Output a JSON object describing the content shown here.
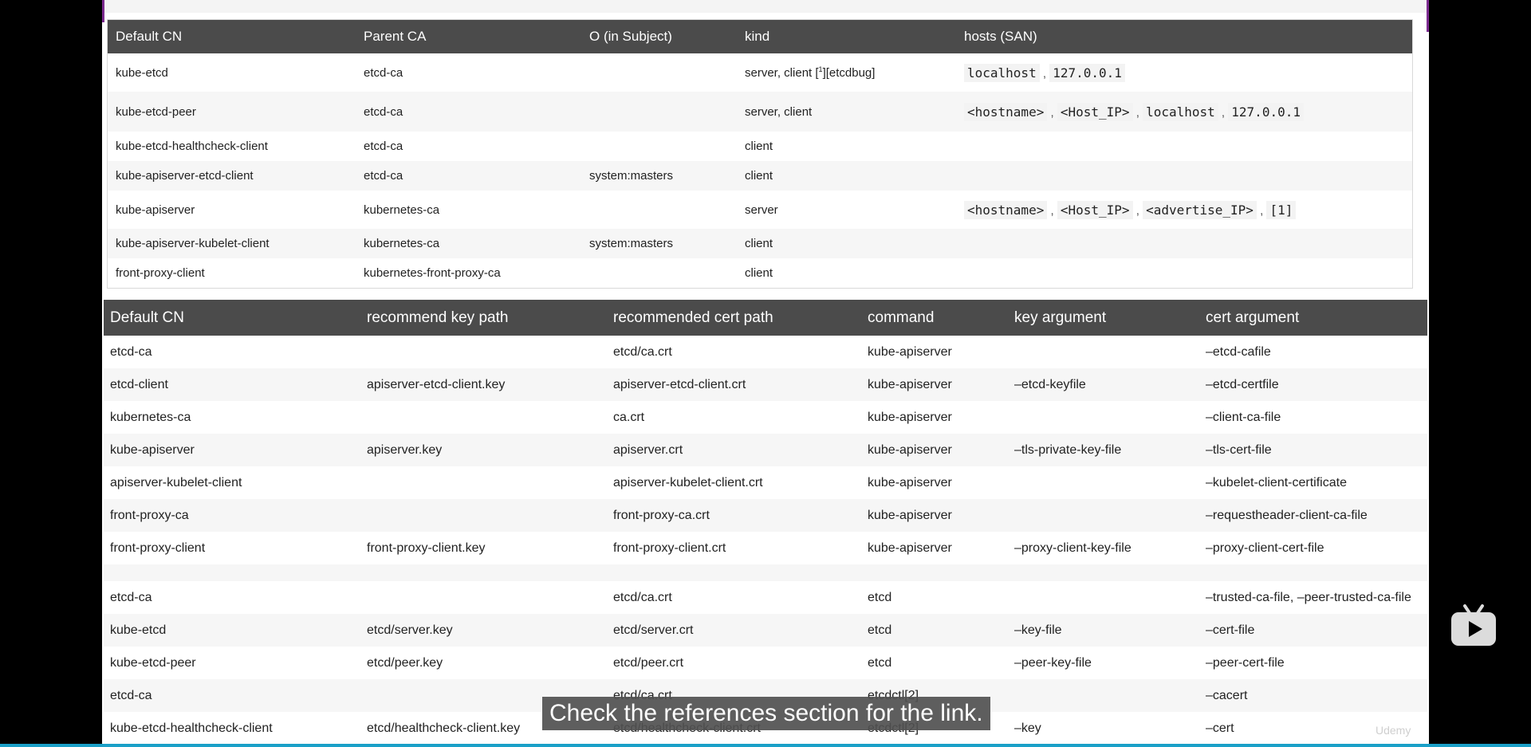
{
  "table1": {
    "headers": [
      "Default CN",
      "Parent CA",
      "O (in Subject)",
      "kind",
      "hosts (SAN)"
    ],
    "rows": [
      {
        "cn": "kube-etcd",
        "parent": "etcd-ca",
        "o": "",
        "kind_prefix": "server, client [",
        "kind_sup": "1",
        "kind_suffix": "][etcdbug]",
        "hosts": [
          "localhost",
          "127.0.0.1"
        ]
      },
      {
        "cn": "kube-etcd-peer",
        "parent": "etcd-ca",
        "o": "",
        "kind": "server, client",
        "hosts": [
          "<hostname>",
          "<Host_IP>",
          "localhost",
          "127.0.0.1"
        ]
      },
      {
        "cn": "kube-etcd-healthcheck-client",
        "parent": "etcd-ca",
        "o": "",
        "kind": "client",
        "hosts": []
      },
      {
        "cn": "kube-apiserver-etcd-client",
        "parent": "etcd-ca",
        "o": "system:masters",
        "kind": "client",
        "hosts": []
      },
      {
        "cn": "kube-apiserver",
        "parent": "kubernetes-ca",
        "o": "",
        "kind": "server",
        "hosts": [
          "<hostname>",
          "<Host_IP>",
          "<advertise_IP>",
          "[1]"
        ]
      },
      {
        "cn": "kube-apiserver-kubelet-client",
        "parent": "kubernetes-ca",
        "o": "system:masters",
        "kind": "client",
        "hosts": []
      },
      {
        "cn": "front-proxy-client",
        "parent": "kubernetes-front-proxy-ca",
        "o": "",
        "kind": "client",
        "hosts": []
      }
    ]
  },
  "table2": {
    "headers": [
      "Default CN",
      "recommend key path",
      "recommended cert path",
      "command",
      "key argument",
      "cert argument"
    ],
    "rows": [
      [
        "etcd-ca",
        "",
        "etcd/ca.crt",
        "kube-apiserver",
        "",
        "–etcd-cafile"
      ],
      [
        "etcd-client",
        "apiserver-etcd-client.key",
        "apiserver-etcd-client.crt",
        "kube-apiserver",
        "–etcd-keyfile",
        "–etcd-certfile"
      ],
      [
        "kubernetes-ca",
        "",
        "ca.crt",
        "kube-apiserver",
        "",
        "–client-ca-file"
      ],
      [
        "kube-apiserver",
        "apiserver.key",
        "apiserver.crt",
        "kube-apiserver",
        "–tls-private-key-file",
        "–tls-cert-file"
      ],
      [
        "apiserver-kubelet-client",
        "",
        "apiserver-kubelet-client.crt",
        "kube-apiserver",
        "",
        "–kubelet-client-certificate"
      ],
      [
        "front-proxy-ca",
        "",
        "front-proxy-ca.crt",
        "kube-apiserver",
        "",
        "–requestheader-client-ca-file"
      ],
      [
        "front-proxy-client",
        "front-proxy-client.key",
        "front-proxy-client.crt",
        "kube-apiserver",
        "–proxy-client-key-file",
        "–proxy-client-cert-file"
      ],
      [
        "",
        "",
        "",
        "",
        "",
        ""
      ],
      [
        "etcd-ca",
        "",
        "etcd/ca.crt",
        "etcd",
        "",
        "–trusted-ca-file, –peer-trusted-ca-file"
      ],
      [
        "kube-etcd",
        "etcd/server.key",
        "etcd/server.crt",
        "etcd",
        "–key-file",
        "–cert-file"
      ],
      [
        "kube-etcd-peer",
        "etcd/peer.key",
        "etcd/peer.crt",
        "etcd",
        "–peer-key-file",
        "–peer-cert-file"
      ],
      [
        "etcd-ca",
        "",
        "etcd/ca.crt",
        "etcdctl[2]",
        "",
        "–cacert"
      ],
      [
        "kube-etcd-healthcheck-client",
        "etcd/healthcheck-client.key",
        "etcd/healthcheck-client.crt",
        "etcdctl[2]",
        "–key",
        "–cert"
      ]
    ]
  },
  "overlay": {
    "subtitle": "Check the references section for the link.",
    "watermark": "Udemy",
    "player_icon": "bilibili-tv-icon"
  }
}
